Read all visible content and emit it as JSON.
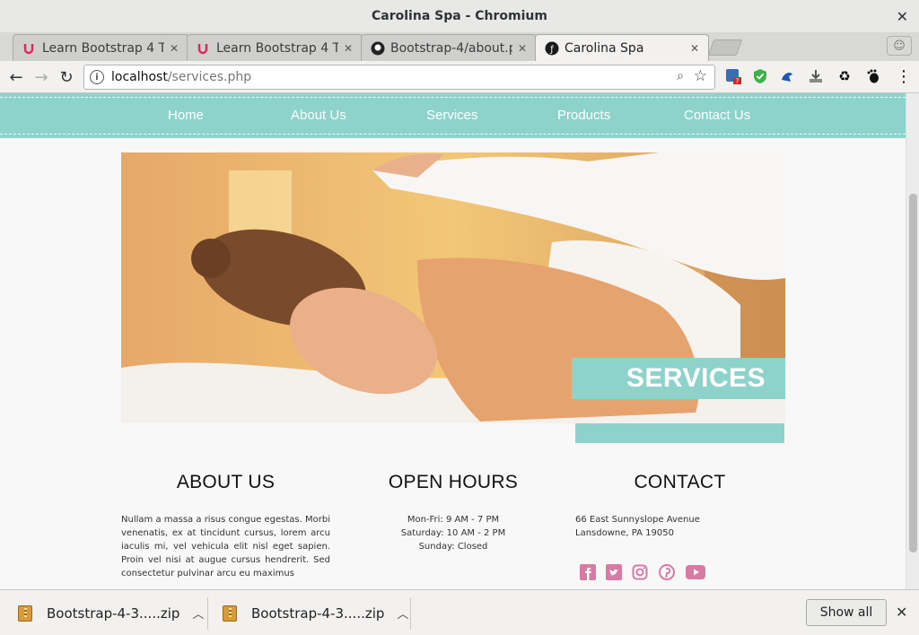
{
  "window": {
    "title": "Carolina Spa - Chromium"
  },
  "tabs": [
    {
      "label": "Learn Bootstrap 4 T",
      "icon": "udemy-icon"
    },
    {
      "label": "Learn Bootstrap 4 T",
      "icon": "udemy-icon"
    },
    {
      "label": "Bootstrap-4/about.p",
      "icon": "github-icon"
    },
    {
      "label": "Carolina Spa",
      "icon": "page-icon",
      "active": true
    }
  ],
  "toolbar": {
    "url_host": "localhost",
    "url_path": "/services.php",
    "extension_badge": "7"
  },
  "page": {
    "nav": [
      "Home",
      "About Us",
      "Services",
      "Products",
      "Contact Us"
    ],
    "hero_title": "SERVICES",
    "about": {
      "title": "ABOUT US",
      "text": "Nullam a massa a risus congue egestas. Morbi venenatis, ex at tincidunt cursus, lorem arcu iaculis mi, vel vehicula elit nisl eget sapien. Proin vel nisi at augue cursus hendrerit. Sed consectetur pulvinar arcu eu maximus"
    },
    "hours": {
      "title": "OPEN HOURS",
      "lines": [
        "Mon-Fri: 9 AM - 7 PM",
        "Saturday: 10 AM - 2 PM",
        "Sunday: Closed"
      ]
    },
    "contact": {
      "title": "CONTACT",
      "address_1": "66 East Sunnyslope Avenue",
      "address_2": "Lansdowne, PA 19050",
      "social": [
        "facebook-icon",
        "twitter-icon",
        "instagram-icon",
        "pinterest-icon",
        "youtube-icon"
      ]
    },
    "colors": {
      "accent": "#8dd3cb",
      "social": "#d97aa4"
    }
  },
  "downloads": {
    "items": [
      "Bootstrap-4-3.....zip",
      "Bootstrap-4-3.....zip"
    ],
    "show_all": "Show all"
  }
}
